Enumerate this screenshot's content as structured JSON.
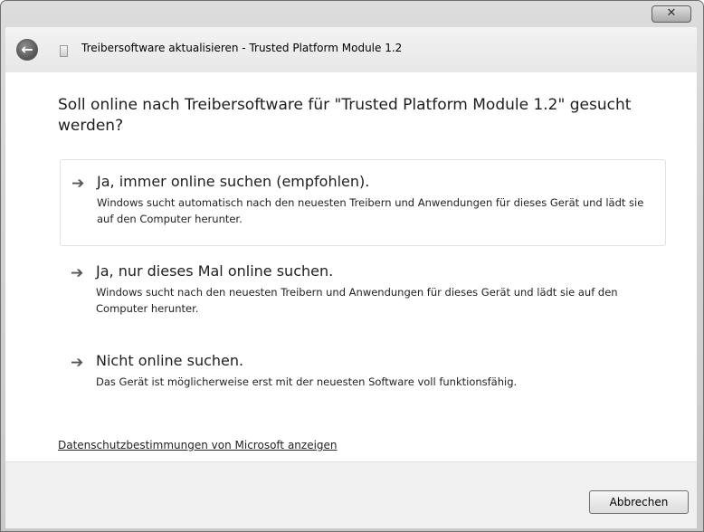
{
  "window": {
    "title": "Treibersoftware aktualisieren - Trusted Platform Module 1.2",
    "close_label": "x"
  },
  "header": {
    "back_icon": "arrow-left-icon",
    "app_icon": "driver-icon"
  },
  "instruction": "Soll online nach Treibersoftware für \"Trusted Platform Module 1.2\" gesucht werden?",
  "options": [
    {
      "title": "Ja, immer online suchen (empfohlen).",
      "description": "Windows sucht automatisch nach den neuesten Treibern und Anwendungen für dieses Gerät und lädt sie auf den Computer herunter.",
      "icon": "arrow-right-icon",
      "selected": true
    },
    {
      "title": "Ja, nur dieses Mal online suchen.",
      "description": "Windows sucht nach den neuesten Treibern und Anwendungen für dieses Gerät und lädt sie auf den Computer herunter.",
      "icon": "arrow-right-icon",
      "selected": false
    },
    {
      "title": "Nicht online suchen.",
      "description": "Das Gerät ist möglicherweise erst mit der neuesten Software voll funktionsfähig.",
      "icon": "arrow-right-icon",
      "selected": false
    }
  ],
  "privacy_link": "Datenschutzbestimmungen von Microsoft anzeigen",
  "footer": {
    "cancel_label": "Abbrechen"
  }
}
